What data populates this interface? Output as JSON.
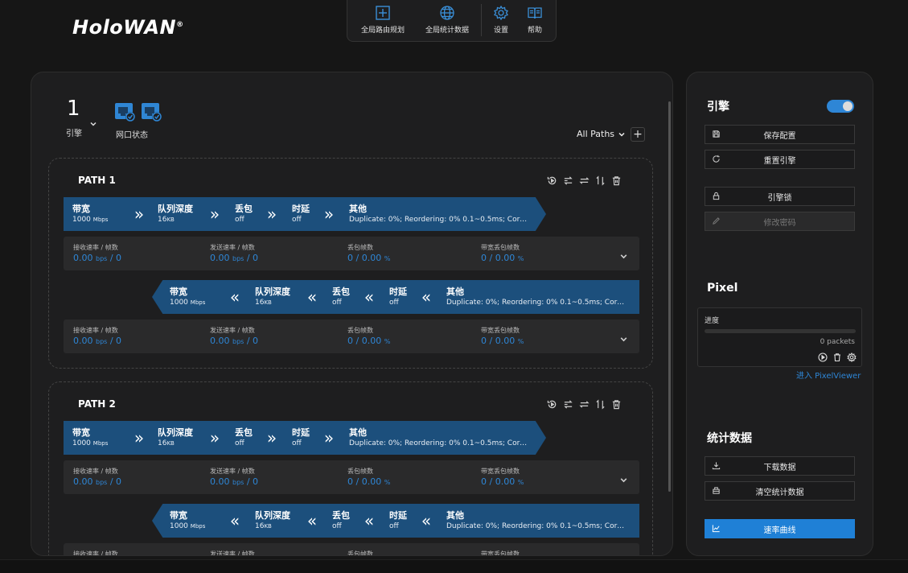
{
  "logo": {
    "text": "HoloWAN",
    "mark": "®"
  },
  "topnav": [
    {
      "label": "全局路由规划",
      "icon": "route-plan-icon"
    },
    {
      "label": "全局统计数据",
      "icon": "globe-icon"
    },
    {
      "label": "设置",
      "icon": "gear-icon"
    },
    {
      "label": "帮助",
      "icon": "book-icon"
    }
  ],
  "engine": {
    "number": "1",
    "label": "引擎",
    "port_label": "网口状态"
  },
  "filter": {
    "all_paths": "All Paths"
  },
  "paths": [
    {
      "title": "PATH 1",
      "forward": {
        "bandwidth_label": "带宽",
        "bandwidth_value": "1000",
        "bandwidth_unit": "Mbps",
        "queue_label": "队列深度",
        "queue_value": "16",
        "queue_unit": "KB",
        "loss_label": "丢包",
        "loss_value": "off",
        "delay_label": "时延",
        "delay_value": "off",
        "other_label": "其他",
        "other_value": "Duplicate: 0%; Reordering: 0% 0.1~0.5ms; Corr..."
      },
      "forward_stats": {
        "recv_label": "接收速率 / 帧数",
        "recv_value": "0.00",
        "recv_unit": "bps",
        "recv_frames": "/ 0",
        "send_label": "发送速率 / 帧数",
        "send_value": "0.00",
        "send_unit": "bps",
        "send_frames": "/ 0",
        "drop_label": "丢包帧数",
        "drop_value": "0 / 0.00",
        "drop_unit": "%",
        "bwdrop_label": "带宽丢包帧数",
        "bwdrop_value": "0 / 0.00",
        "bwdrop_unit": "%"
      },
      "reverse": {
        "bandwidth_label": "带宽",
        "bandwidth_value": "1000",
        "bandwidth_unit": "Mbps",
        "queue_label": "队列深度",
        "queue_value": "16",
        "queue_unit": "KB",
        "loss_label": "丢包",
        "loss_value": "off",
        "delay_label": "时延",
        "delay_value": "off",
        "other_label": "其他",
        "other_value": "Duplicate: 0%; Reordering: 0% 0.1~0.5ms; Corr..."
      },
      "reverse_stats": {
        "recv_label": "接收速率 / 帧数",
        "recv_value": "0.00",
        "recv_unit": "bps",
        "recv_frames": "/ 0",
        "send_label": "发送速率 / 帧数",
        "send_value": "0.00",
        "send_unit": "bps",
        "send_frames": "/ 0",
        "drop_label": "丢包帧数",
        "drop_value": "0 / 0.00",
        "drop_unit": "%",
        "bwdrop_label": "带宽丢包帧数",
        "bwdrop_value": "0 / 0.00",
        "bwdrop_unit": "%"
      }
    },
    {
      "title": "PATH 2",
      "forward": {
        "bandwidth_label": "带宽",
        "bandwidth_value": "1000",
        "bandwidth_unit": "Mbps",
        "queue_label": "队列深度",
        "queue_value": "16",
        "queue_unit": "KB",
        "loss_label": "丢包",
        "loss_value": "off",
        "delay_label": "时延",
        "delay_value": "off",
        "other_label": "其他",
        "other_value": "Duplicate: 0%; Reordering: 0% 0.1~0.5ms; Corr..."
      },
      "forward_stats": {
        "recv_label": "接收速率 / 帧数",
        "recv_value": "0.00",
        "recv_unit": "bps",
        "recv_frames": "/ 0",
        "send_label": "发送速率 / 帧数",
        "send_value": "0.00",
        "send_unit": "bps",
        "send_frames": "/ 0",
        "drop_label": "丢包帧数",
        "drop_value": "0 / 0.00",
        "drop_unit": "%",
        "bwdrop_label": "带宽丢包帧数",
        "bwdrop_value": "0 / 0.00",
        "bwdrop_unit": "%"
      },
      "reverse": {
        "bandwidth_label": "带宽",
        "bandwidth_value": "1000",
        "bandwidth_unit": "Mbps",
        "queue_label": "队列深度",
        "queue_value": "16",
        "queue_unit": "KB",
        "loss_label": "丢包",
        "loss_value": "off",
        "delay_label": "时延",
        "delay_value": "off",
        "other_label": "其他",
        "other_value": "Duplicate: 0%; Reordering: 0% 0.1~0.5ms; Corr..."
      },
      "reverse_stats": {
        "recv_label": "接收速率 / 帧数",
        "send_label": "发送速率 / 帧数",
        "drop_label": "丢包帧数",
        "bwdrop_label": "带宽丢包帧数"
      }
    }
  ],
  "side": {
    "engine_title": "引擎",
    "save_config": "保存配置",
    "reset_engine": "重置引擎",
    "engine_lock": "引擎锁",
    "change_password": "修改密码",
    "pixel_title": "Pixel",
    "progress_label": "进度",
    "progress_fraction": 0,
    "packets": "0 packets",
    "pixel_link": "进入 PixelViewer",
    "stats_title": "统计数据",
    "download_data": "下载数据",
    "clear_stats": "清空统计数据",
    "rate_curve": "速率曲线"
  },
  "colors": {
    "accent": "#2e86d6",
    "flow_bg": "#1c4f7c",
    "panel_bg": "#1e1e1f",
    "page_bg": "#161616"
  }
}
